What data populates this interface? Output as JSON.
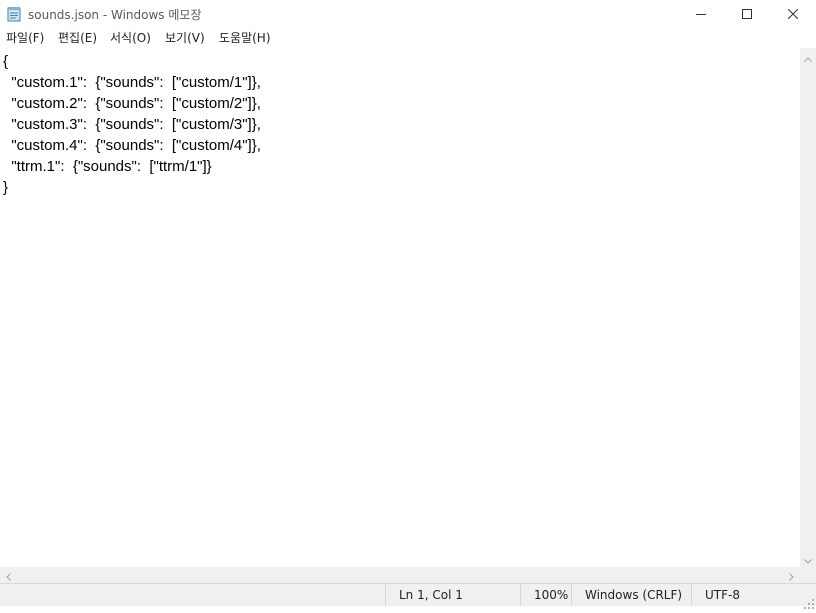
{
  "window": {
    "title": "sounds.json - Windows 메모장",
    "icon": "notepad-icon",
    "controls": [
      "minimize-icon",
      "maximize-icon",
      "close-icon"
    ]
  },
  "menu": {
    "file": "파일(F)",
    "edit": "편집(E)",
    "format": "서식(O)",
    "view": "보기(V)",
    "help": "도움말(H)"
  },
  "editor": {
    "content": "{\n  \"custom.1\":  {\"sounds\":  [\"custom/1\"]},\n  \"custom.2\":  {\"sounds\":  [\"custom/2\"]},\n  \"custom.3\":  {\"sounds\":  [\"custom/3\"]},\n  \"custom.4\":  {\"sounds\":  [\"custom/4\"]},\n  \"ttrm.1\":  {\"sounds\":  [\"ttrm/1\"]}\n}"
  },
  "status": {
    "position": "Ln 1, Col 1",
    "zoom": "100%",
    "line_ending": "Windows (CRLF)",
    "encoding": "UTF-8"
  },
  "colors": {
    "background": "#ffffff",
    "chrome": "#f0f0f0",
    "text": "#000000"
  }
}
